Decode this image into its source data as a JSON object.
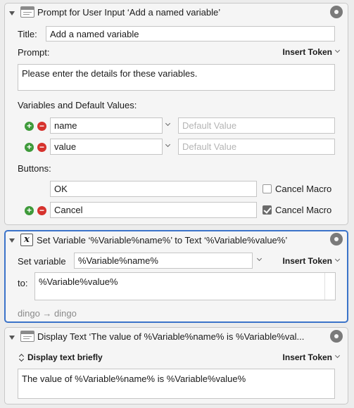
{
  "prompt_action": {
    "title": "Prompt for User Input ‘Add a named variable’",
    "title_label": "Title:",
    "title_value": "Add a named variable",
    "prompt_label": "Prompt:",
    "insert_token": "Insert Token",
    "prompt_text": "Please enter the details for these variables.",
    "variables_label": "Variables and Default Values:",
    "variables": [
      {
        "name": "name",
        "default_placeholder": "Default Value"
      },
      {
        "name": "value",
        "default_placeholder": "Default Value"
      }
    ],
    "buttons_label": "Buttons:",
    "buttons": [
      {
        "label": "OK",
        "cancel_label": "Cancel Macro",
        "cancel_checked": false
      },
      {
        "label": "Cancel",
        "cancel_label": "Cancel Macro",
        "cancel_checked": true
      }
    ]
  },
  "set_variable_action": {
    "title": "Set Variable ‘%Variable%name%’ to Text ‘%Variable%value%’",
    "icon_glyph": "x",
    "set_label": "Set variable",
    "variable_value": "%Variable%name%",
    "insert_token": "Insert Token",
    "to_label": "to:",
    "text_value": "%Variable%value%",
    "preview": "dingo → dingo"
  },
  "display_text_action": {
    "title": "Display Text ‘The value of %Variable%name% is %Variable%val...",
    "mode": "Display text briefly",
    "insert_token": "Insert Token",
    "text_value": "The value of %Variable%name% is %Variable%value%"
  },
  "colors": {
    "selected_border": "#3b73c9",
    "add_button": "#3e9a3a",
    "remove_button": "#d6322d"
  }
}
